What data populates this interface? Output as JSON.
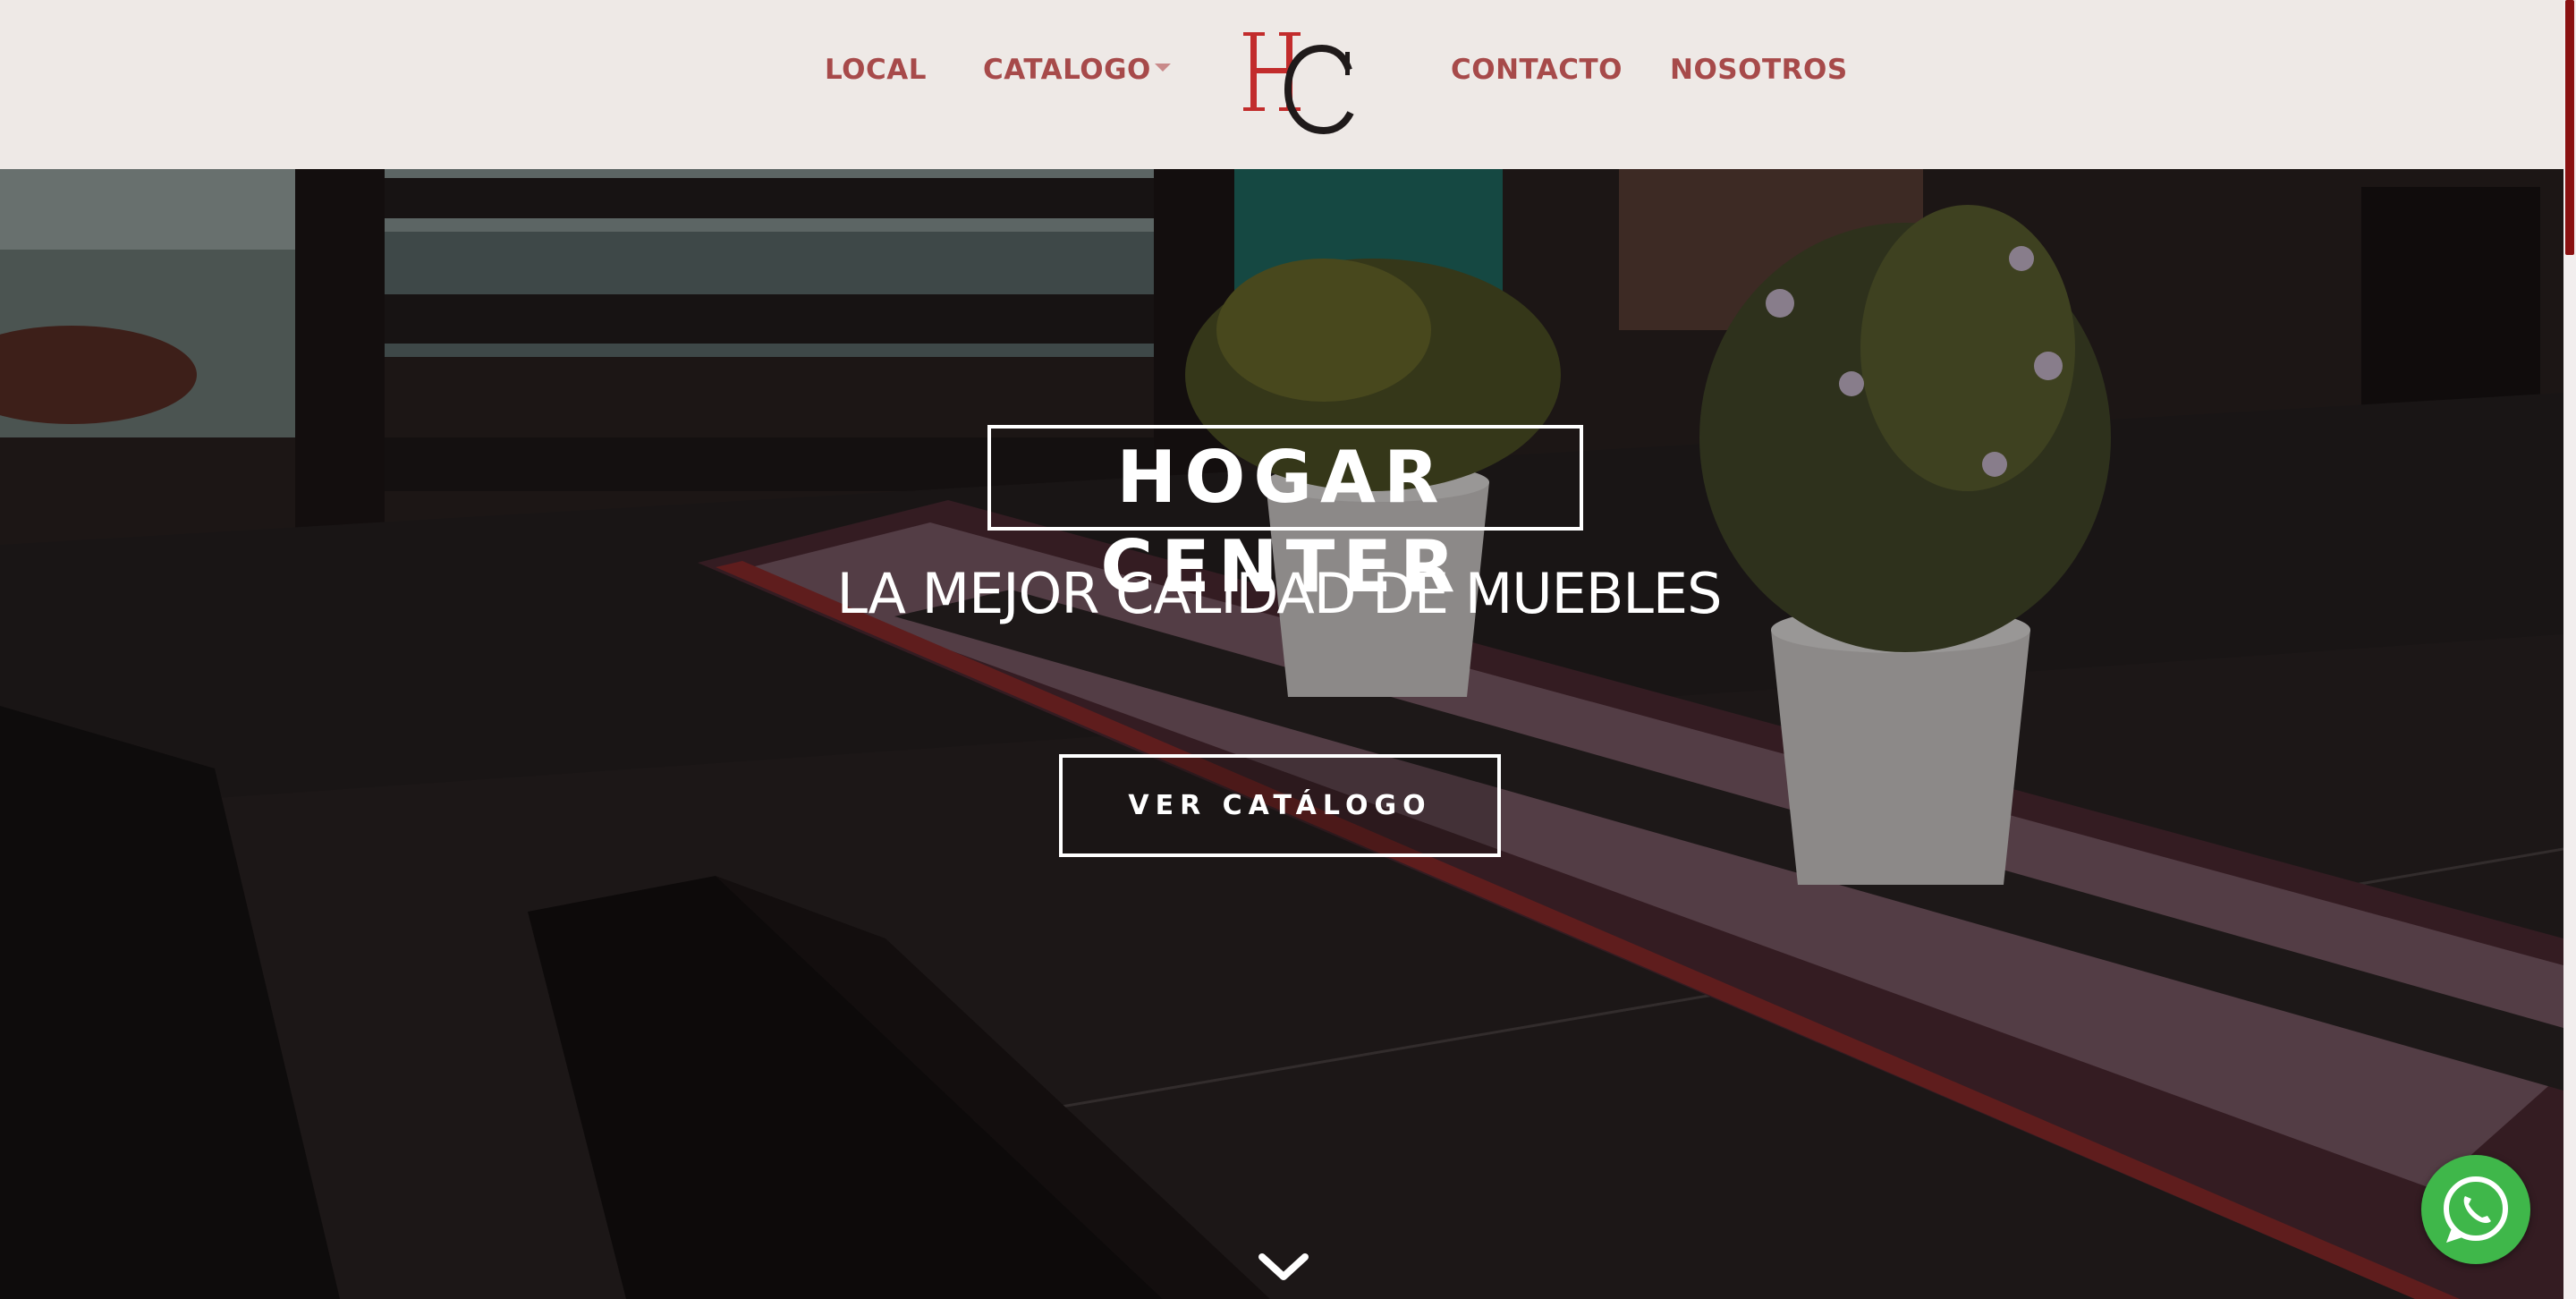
{
  "nav": {
    "items": [
      {
        "label": "LOCAL"
      },
      {
        "label": "CATALOGO",
        "has_dropdown": true
      },
      {
        "label": "CONTACTO"
      },
      {
        "label": "NOSOTROS"
      }
    ],
    "logo_letters": "HC",
    "colors": {
      "background": "#eee9e6",
      "link": "#a74a4a",
      "logo_red": "#c22c2c",
      "logo_dark": "#1f1a1a"
    }
  },
  "hero": {
    "title": "HOGAR CENTER",
    "subtitle": "LA MEJOR CALIDAD DE MUEBLES",
    "cta_label": "VER CATÁLOGO",
    "scroll_icon": "chevron-down-icon"
  },
  "floating": {
    "whatsapp_icon": "whatsapp-icon",
    "whatsapp_color": "#3fb74a"
  }
}
